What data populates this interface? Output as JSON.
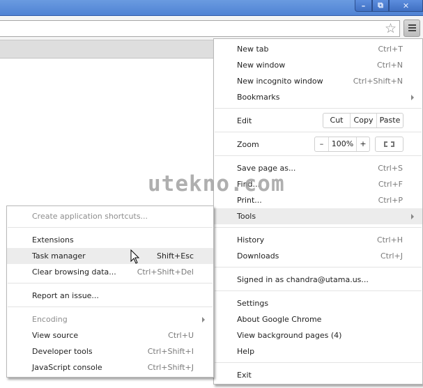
{
  "window": {
    "controls": {
      "minimize": "–",
      "maximize": "⧉",
      "close": "✕"
    }
  },
  "toolbar": {
    "star_icon": "☆",
    "menu_icon": "hamburger-icon"
  },
  "watermark": "utekno.com",
  "main_menu": {
    "items": [
      {
        "label": "New tab",
        "shortcut": "Ctrl+T"
      },
      {
        "label": "New window",
        "shortcut": "Ctrl+N"
      },
      {
        "label": "New incognito window",
        "shortcut": "Ctrl+Shift+N"
      },
      {
        "label": "Bookmarks",
        "submenu": true
      },
      {
        "label": "Edit",
        "buttons": [
          "Cut",
          "Copy",
          "Paste"
        ]
      },
      {
        "label": "Zoom",
        "zoom_minus": "–",
        "zoom_value": "100%",
        "zoom_plus": "+"
      },
      {
        "label": "Save page as...",
        "shortcut": "Ctrl+S"
      },
      {
        "label": "Find...",
        "shortcut": "Ctrl+F"
      },
      {
        "label": "Print...",
        "shortcut": "Ctrl+P"
      },
      {
        "label": "Tools",
        "submenu": true,
        "highlighted": true
      },
      {
        "label": "History",
        "shortcut": "Ctrl+H"
      },
      {
        "label": "Downloads",
        "shortcut": "Ctrl+J"
      },
      {
        "label": "Signed in as chandra@utama.us..."
      },
      {
        "label": "Settings"
      },
      {
        "label": "About Google Chrome"
      },
      {
        "label": "View background pages (4)"
      },
      {
        "label": "Help"
      },
      {
        "label": "Exit"
      }
    ]
  },
  "tools_menu": {
    "items": [
      {
        "label": "Create application shortcuts...",
        "disabled": true
      },
      {
        "label": "Extensions"
      },
      {
        "label": "Task manager",
        "shortcut": "Shift+Esc",
        "highlighted": true
      },
      {
        "label": "Clear browsing data...",
        "shortcut": "Ctrl+Shift+Del"
      },
      {
        "label": "Report an issue..."
      },
      {
        "label": "Encoding",
        "disabled": true,
        "submenu": true
      },
      {
        "label": "View source",
        "shortcut": "Ctrl+U"
      },
      {
        "label": "Developer tools",
        "shortcut": "Ctrl+Shift+I"
      },
      {
        "label": "JavaScript console",
        "shortcut": "Ctrl+Shift+J"
      }
    ]
  }
}
